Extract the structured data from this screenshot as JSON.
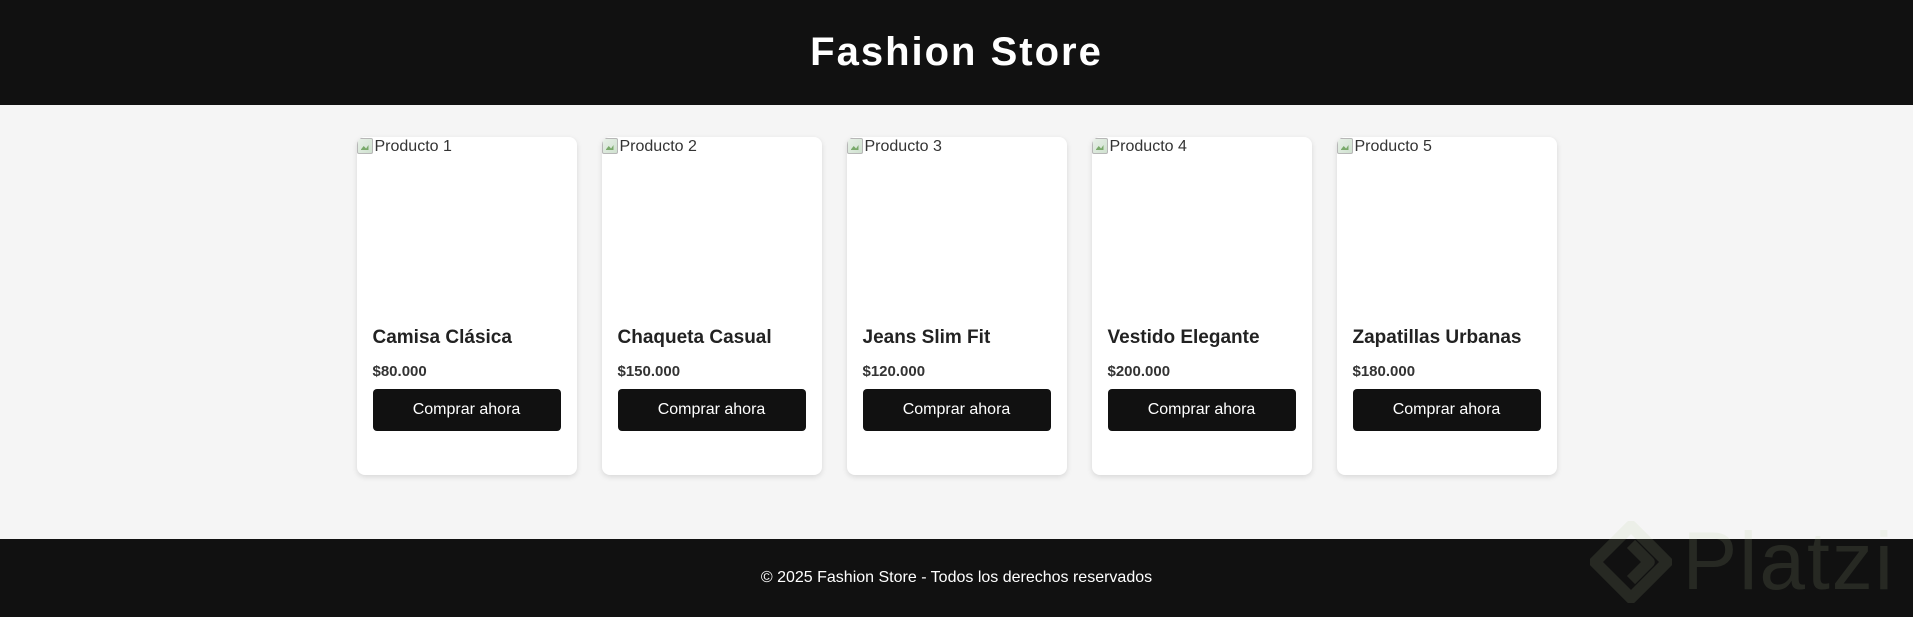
{
  "header": {
    "title": "Fashion Store"
  },
  "products": [
    {
      "img_alt": "Producto 1",
      "name": "Camisa Clásica",
      "price": "$80.000",
      "button": "Comprar ahora"
    },
    {
      "img_alt": "Producto 2",
      "name": "Chaqueta Casual",
      "price": "$150.000",
      "button": "Comprar ahora"
    },
    {
      "img_alt": "Producto 3",
      "name": "Jeans Slim Fit",
      "price": "$120.000",
      "button": "Comprar ahora"
    },
    {
      "img_alt": "Producto 4",
      "name": "Vestido Elegante",
      "price": "$200.000",
      "button": "Comprar ahora"
    },
    {
      "img_alt": "Producto 5",
      "name": "Zapatillas Urbanas",
      "price": "$180.000",
      "button": "Comprar ahora"
    }
  ],
  "footer": {
    "text": "© 2025 Fashion Store - Todos los derechos reservados"
  },
  "watermark": {
    "text": "Platzi",
    "icon": "platzi-logo-icon"
  },
  "colors": {
    "header_bg": "#111111",
    "page_bg": "#f5f5f5",
    "card_bg": "#ffffff",
    "button_bg": "#111111",
    "button_text": "#ffffff"
  }
}
